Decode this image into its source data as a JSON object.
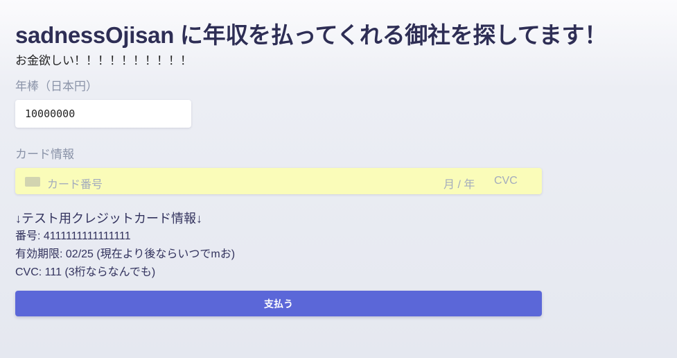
{
  "header": {
    "title": "sadnessOjisan に年収を払ってくれる御社を探してます！",
    "subtitle": "お金欲しい！！！！！！！！！！"
  },
  "form": {
    "salary_label": "年棒（日本円）",
    "salary_value": "10000000",
    "card_label": "カード情報",
    "card_number_placeholder": "カード番号",
    "expiry_placeholder": "月 / 年",
    "cvc_placeholder": "CVC",
    "card_field_color": "#fafcb9",
    "pay_button": "支払う",
    "pay_button_color": "#5b67d8"
  },
  "test_info": {
    "heading": "↓テスト用クレジットカード情報↓",
    "number": "番号: 4111111111111111",
    "expiry": "有効期限: 02/25 (現在より後ならいつでmお)",
    "cvc": "CVC: 111 (3桁ならなんでも)"
  }
}
